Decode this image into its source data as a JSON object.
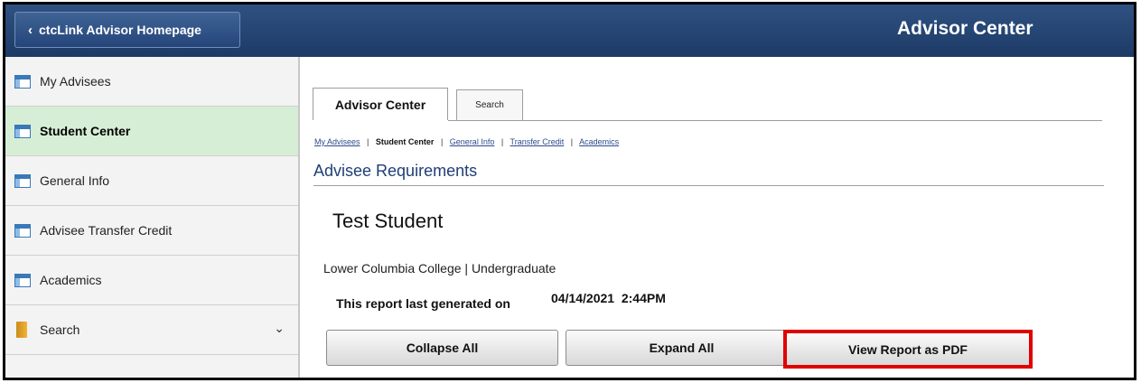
{
  "header": {
    "home_button_label": "ctcLink Advisor Homepage",
    "app_title": "Advisor Center"
  },
  "sidebar": {
    "items": [
      {
        "label": "My Advisees",
        "icon": "window-icon"
      },
      {
        "label": "Student Center",
        "icon": "window-icon",
        "active": true
      },
      {
        "label": "General Info",
        "icon": "window-icon"
      },
      {
        "label": "Advisee Transfer Credit",
        "icon": "window-icon"
      },
      {
        "label": "Academics",
        "icon": "window-icon"
      },
      {
        "label": "Search",
        "icon": "folder-icon"
      }
    ]
  },
  "tabs": [
    {
      "label": "Advisor Center",
      "active": true
    },
    {
      "label": "Search"
    }
  ],
  "breadcrumb": {
    "items": [
      "My Advisees",
      "Student Center",
      "General Info",
      "Transfer Credit",
      "Academics"
    ],
    "separator": "|"
  },
  "page": {
    "title": "Advisee Requirements",
    "student_name": "Test Student",
    "institution_career": "Lower Columbia College | Undergraduate",
    "generated_label": "This report last generated on",
    "generated_datetime": "04/14/2021  2:44PM"
  },
  "buttons": {
    "collapse_all": "Collapse All",
    "expand_all": "Expand All",
    "view_pdf": "View Report as PDF"
  },
  "colors": {
    "header_bg": "#1d3a66",
    "active_nav_bg": "#d7eed6",
    "title_color": "#1f3e76",
    "highlight_border": "#e00000"
  }
}
